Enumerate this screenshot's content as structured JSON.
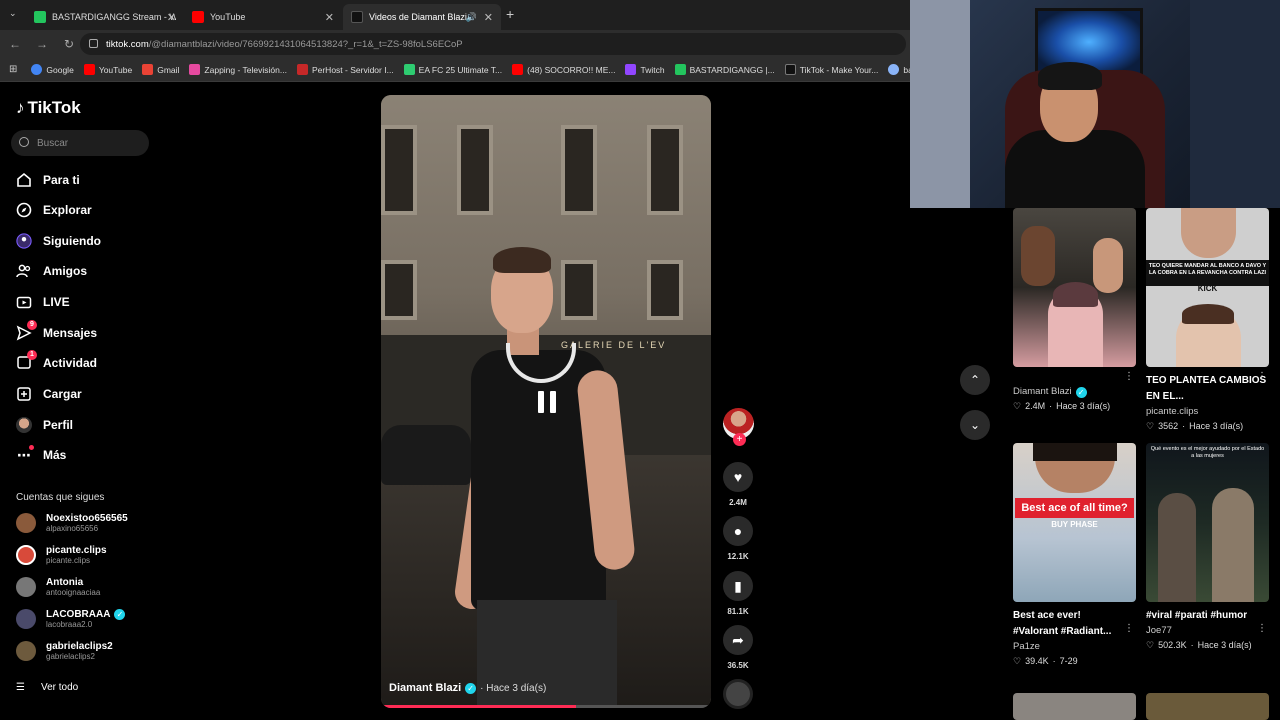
{
  "browser": {
    "tabs": [
      {
        "label": "BASTARDIGANGG Stream - Wat",
        "fav_color": "#23c55e"
      },
      {
        "label": "YouTube",
        "fav_color": "#ff0000"
      },
      {
        "label": "Videos de Diamant Blazi (@",
        "fav_color": "#111111"
      }
    ],
    "new_tab": "+",
    "url_host": "tiktok.com",
    "url_rest": "/@diamantblazi/video/7669921431064513824?_r=1&_t=ZS-98foLS6ECoP",
    "bookmarks": [
      {
        "label": "Google",
        "fav_color": "#4285f4"
      },
      {
        "label": "YouTube",
        "fav_color": "#ff0000"
      },
      {
        "label": "Gmail",
        "fav_color": "#ea4335"
      },
      {
        "label": "Zapping - Televisión...",
        "fav_color": "#e64aa0"
      },
      {
        "label": "PerHost - Servidor I...",
        "fav_color": "#c62828"
      },
      {
        "label": "EA FC 25 Ultimate T...",
        "fav_color": "#2ecc71"
      },
      {
        "label": "(48) SOCORRO!! ME...",
        "fav_color": "#ff0000"
      },
      {
        "label": "Twitch",
        "fav_color": "#9146ff"
      },
      {
        "label": "BASTARDIGANGG |...",
        "fav_color": "#23c55e"
      },
      {
        "label": "TikTok - Make Your...",
        "fav_color": "#111111"
      },
      {
        "label": "bastardigar",
        "fav_color": "#8ab4f8"
      }
    ]
  },
  "sidebar": {
    "logo": "TikTok",
    "search_placeholder": "Buscar",
    "nav": [
      {
        "label": "Para ti",
        "icon": "home-icon"
      },
      {
        "label": "Explorar",
        "icon": "compass-icon"
      },
      {
        "label": "Siguiendo",
        "icon": "following-icon"
      },
      {
        "label": "Amigos",
        "icon": "friends-icon"
      },
      {
        "label": "LIVE",
        "icon": "live-icon"
      },
      {
        "label": "Mensajes",
        "icon": "messages-icon",
        "badge": "9"
      },
      {
        "label": "Actividad",
        "icon": "activity-icon",
        "badge": "1"
      },
      {
        "label": "Cargar",
        "icon": "upload-icon"
      },
      {
        "label": "Perfil",
        "icon": "profile-icon"
      },
      {
        "label": "Más",
        "icon": "more-icon"
      }
    ],
    "following_title": "Cuentas que sigues",
    "following": [
      {
        "name": "Noexistoo656565",
        "handle": "alpaxino65656",
        "color": "#8a5a3b"
      },
      {
        "name": "picante.clips",
        "handle": "picante.clips",
        "color": "#d84a3a"
      },
      {
        "name": "Antonia",
        "handle": "antooignaaciaa",
        "color": "#777777"
      },
      {
        "name": "LACOBRAAA",
        "handle": "lacobraaa2.0",
        "color": "#4a4a6a",
        "verified": true
      },
      {
        "name": "gabrielaclips2",
        "handle": "gabrielaclips2",
        "color": "#6d5a3d"
      }
    ],
    "see_all": "Ver todo"
  },
  "video": {
    "author": "Diamant Blazi",
    "date": "· Hace 3 día(s)",
    "shop_sign": "GALERIE DE L'EV",
    "progress": 0.59
  },
  "actions": {
    "likes": "2.4M",
    "comments": "12.1K",
    "saves": "81.1K",
    "shares": "36.5K"
  },
  "grid": [
    {
      "title": "",
      "author": "Diamant Blazi",
      "verified": true,
      "likes": "2.4M",
      "date": "Hace 3 día(s)"
    },
    {
      "title": "TEO PLANTEA CAMBIOS EN EL...",
      "author": "picante.clips",
      "likes": "3562",
      "date": "Hace 3 día(s)",
      "overlay_top": "TEO QUIERE MANDAR AL BANCO A DAVO Y LA COBRA EN LA REVANCHA CONTRA LAZI",
      "overlay_mid": "KICK"
    },
    {
      "title": "Best ace ever! #Valorant #Radiant...",
      "author": "Pa1ze",
      "likes": "39.4K",
      "date": "7-29",
      "overlay_top": "Best ace of all time?",
      "overlay_mid": "BUY PHASE"
    },
    {
      "title": "#viral #parati #humor",
      "author": "Joe77",
      "likes": "502.3K",
      "date": "Hace 3 día(s)",
      "overlay_top": "Qué evento es el mejor ayudado por el Estado a las mujeres"
    }
  ]
}
